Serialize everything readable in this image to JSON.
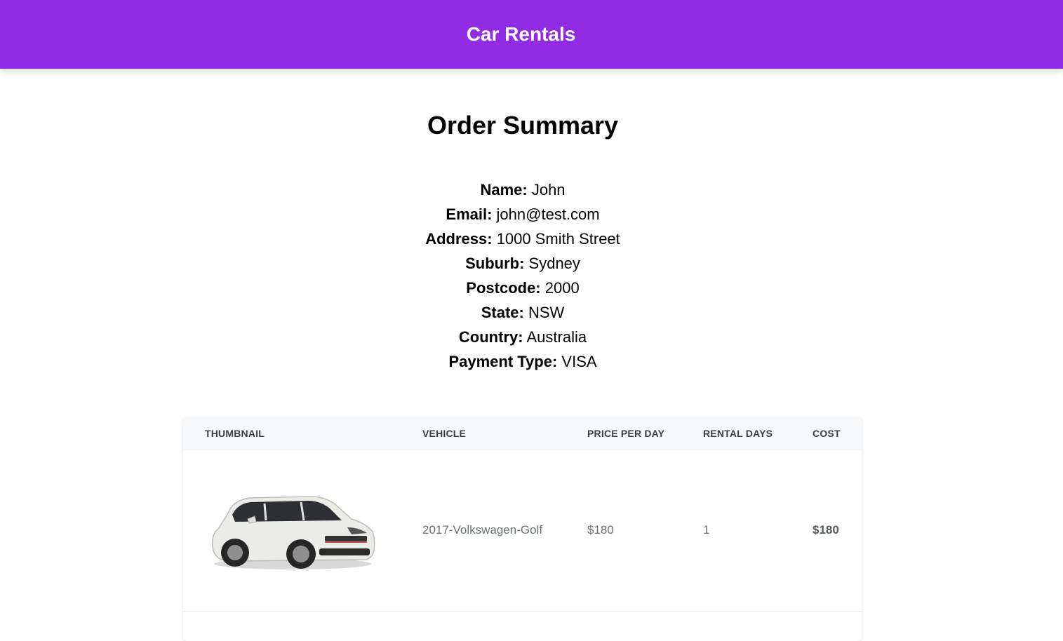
{
  "header": {
    "title": "Car Rentals"
  },
  "page": {
    "title": "Order Summary"
  },
  "customer": [
    {
      "label": "Name:",
      "value": "John"
    },
    {
      "label": "Email:",
      "value": "john@test.com"
    },
    {
      "label": "Address:",
      "value": "1000 Smith Street"
    },
    {
      "label": "Suburb:",
      "value": "Sydney"
    },
    {
      "label": "Postcode:",
      "value": "2000"
    },
    {
      "label": "State:",
      "value": "NSW"
    },
    {
      "label": "Country:",
      "value": "Australia"
    },
    {
      "label": "Payment Type:",
      "value": "VISA"
    }
  ],
  "table": {
    "columns": [
      "THUMBNAIL",
      "VEHICLE",
      "PRICE PER DAY",
      "RENTAL DAYS",
      "COST"
    ],
    "rows": [
      {
        "thumbnail": "car-thumbnail",
        "vehicle": "2017-Volkswagen-Golf",
        "price_per_day": "$180",
        "rental_days": "1",
        "cost": "$180"
      }
    ]
  },
  "colors": {
    "brand": "#922ce3"
  }
}
